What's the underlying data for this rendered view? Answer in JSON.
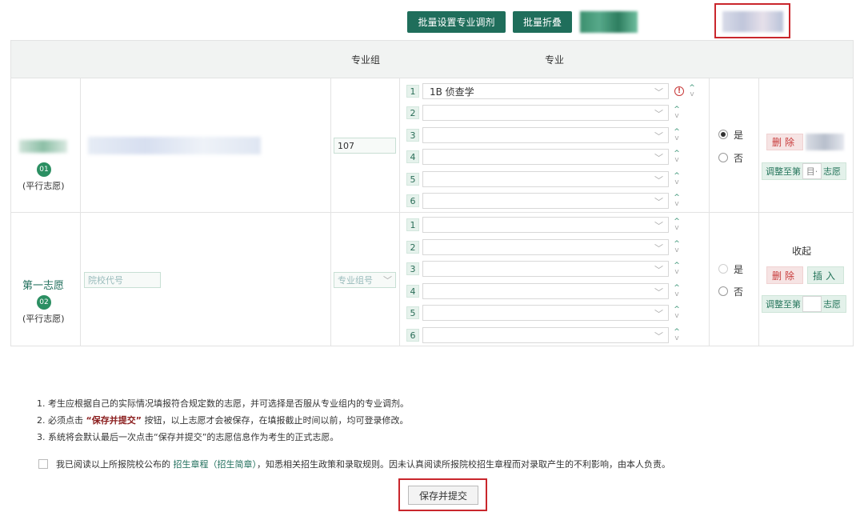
{
  "toolbar": {
    "batch_adjust_label": "批量设置专业调剂",
    "batch_fold_label": "批量折叠"
  },
  "table_header": {
    "group_label": "专业组",
    "major_label": "专业"
  },
  "row1": {
    "badge": "01",
    "type_label": "(平行志愿)",
    "group_code": "107",
    "majors": [
      {
        "num": "1",
        "value": "1B 侦查学"
      },
      {
        "num": "2",
        "value": ""
      },
      {
        "num": "3",
        "value": ""
      },
      {
        "num": "4",
        "value": ""
      },
      {
        "num": "5",
        "value": ""
      },
      {
        "num": "6",
        "value": ""
      }
    ],
    "radio_yes": "是",
    "radio_no": "否",
    "delete_label": "删除",
    "adjust_prefix": "调整至第",
    "adjust_mid": "目·",
    "adjust_suffix": "志愿"
  },
  "row2": {
    "title": "第一志愿",
    "badge": "02",
    "type_label": "(平行志愿)",
    "school_placeholder": "院校代号",
    "group_placeholder": "专业组号",
    "majors": [
      {
        "num": "1",
        "value": ""
      },
      {
        "num": "2",
        "value": ""
      },
      {
        "num": "3",
        "value": ""
      },
      {
        "num": "4",
        "value": ""
      },
      {
        "num": "5",
        "value": ""
      },
      {
        "num": "6",
        "value": ""
      }
    ],
    "collapse_label": "收起",
    "radio_yes": "是",
    "radio_no": "否",
    "delete_label": "删除",
    "insert_label": "插入",
    "adjust_prefix": "调整至第",
    "adjust_suffix": "志愿"
  },
  "notes": {
    "line1": "1. 考生应根据自己的实际情况填报符合规定数的志愿，并可选择是否服从专业组内的专业调剂。",
    "line2_prefix": "2. 必须点击",
    "line2_highlight": "“保存并提交”",
    "line2_suffix": "按钮，以上志愿才会被保存，在填报截止时间以前，均可登录修改。",
    "line3": "3. 系统将会默认最后一次点击“保存并提交”的志愿信息作为考生的正式志愿。"
  },
  "agreement": {
    "prefix": "我已阅读以上所报院校公布的",
    "link": "招生章程（招生简章）",
    "suffix": "，知悉相关招生政策和录取规则。因未认真阅读所报院校招生章程而对录取产生的不利影响，由本人负责。"
  },
  "submit_label": "保存并提交",
  "colors": {
    "brand_green": "#1f6e5b",
    "danger_red": "#c9262c"
  }
}
